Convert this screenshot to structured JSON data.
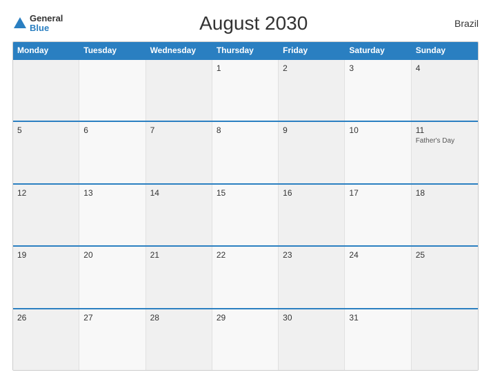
{
  "header": {
    "title": "August 2030",
    "country": "Brazil",
    "logo": {
      "general": "General",
      "blue": "Blue"
    }
  },
  "calendar": {
    "days": [
      "Monday",
      "Tuesday",
      "Wednesday",
      "Thursday",
      "Friday",
      "Saturday",
      "Sunday"
    ],
    "weeks": [
      [
        {
          "num": "",
          "event": ""
        },
        {
          "num": "",
          "event": ""
        },
        {
          "num": "",
          "event": ""
        },
        {
          "num": "1",
          "event": ""
        },
        {
          "num": "2",
          "event": ""
        },
        {
          "num": "3",
          "event": ""
        },
        {
          "num": "4",
          "event": ""
        }
      ],
      [
        {
          "num": "5",
          "event": ""
        },
        {
          "num": "6",
          "event": ""
        },
        {
          "num": "7",
          "event": ""
        },
        {
          "num": "8",
          "event": ""
        },
        {
          "num": "9",
          "event": ""
        },
        {
          "num": "10",
          "event": ""
        },
        {
          "num": "11",
          "event": "Father's Day"
        }
      ],
      [
        {
          "num": "12",
          "event": ""
        },
        {
          "num": "13",
          "event": ""
        },
        {
          "num": "14",
          "event": ""
        },
        {
          "num": "15",
          "event": ""
        },
        {
          "num": "16",
          "event": ""
        },
        {
          "num": "17",
          "event": ""
        },
        {
          "num": "18",
          "event": ""
        }
      ],
      [
        {
          "num": "19",
          "event": ""
        },
        {
          "num": "20",
          "event": ""
        },
        {
          "num": "21",
          "event": ""
        },
        {
          "num": "22",
          "event": ""
        },
        {
          "num": "23",
          "event": ""
        },
        {
          "num": "24",
          "event": ""
        },
        {
          "num": "25",
          "event": ""
        }
      ],
      [
        {
          "num": "26",
          "event": ""
        },
        {
          "num": "27",
          "event": ""
        },
        {
          "num": "28",
          "event": ""
        },
        {
          "num": "29",
          "event": ""
        },
        {
          "num": "30",
          "event": ""
        },
        {
          "num": "31",
          "event": ""
        },
        {
          "num": "",
          "event": ""
        }
      ]
    ]
  }
}
